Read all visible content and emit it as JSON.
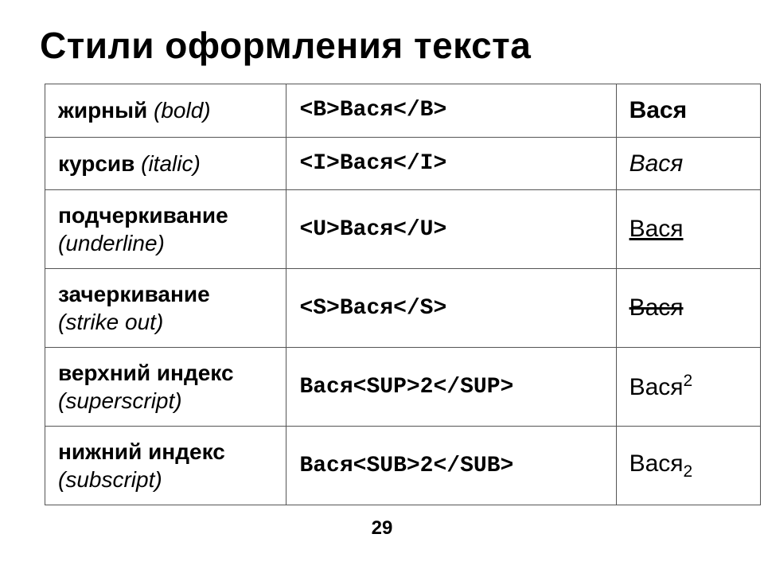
{
  "title": "Стили оформления текста",
  "page_number": "29",
  "rows": [
    {
      "label_ru": "жирный",
      "label_en": "bold",
      "code": "<B>Вася</B>",
      "result_base": "Вася",
      "result_suffix": "",
      "effect": "bold"
    },
    {
      "label_ru": "курсив",
      "label_en": "italic",
      "code": "<I>Вася</I>",
      "result_base": "Вася",
      "result_suffix": "",
      "effect": "italic"
    },
    {
      "label_ru": "подчеркивание",
      "label_en": "underline",
      "code": "<U>Вася</U>",
      "result_base": "Вася",
      "result_suffix": "",
      "effect": "underline"
    },
    {
      "label_ru": "зачеркивание",
      "label_en": "strike out",
      "code": "<S>Вася</S>",
      "result_base": "Вася",
      "result_suffix": "",
      "effect": "strike"
    },
    {
      "label_ru": "верхний индекс",
      "label_en": "superscript",
      "code": "Вася<SUP>2</SUP>",
      "result_base": "Вася",
      "result_suffix": "2",
      "effect": "superscript"
    },
    {
      "label_ru": "нижний индекс",
      "label_en": "subscript",
      "code": "Вася<SUB>2</SUB>",
      "result_base": "Вася",
      "result_suffix": "2",
      "effect": "subscript"
    }
  ]
}
